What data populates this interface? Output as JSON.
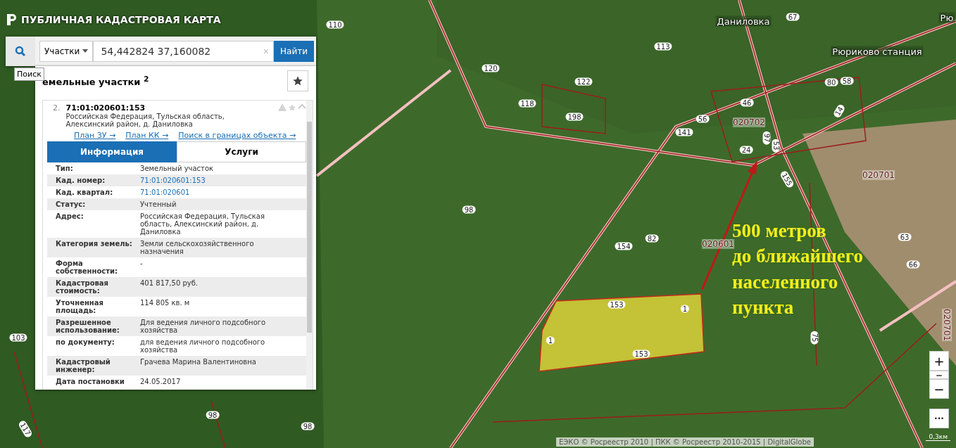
{
  "app": {
    "title": "ПУБЛИЧНАЯ КАДАСТРОВАЯ КАРТА"
  },
  "search": {
    "type_label": "Участки",
    "value": "54,442824 37,160082",
    "clear": "×",
    "submit": "Найти",
    "tooltip": "Поиск"
  },
  "results": {
    "title": "емельные участки $^{2}$",
    "item": {
      "number": "2.",
      "cad_number": "71:01:020601:153",
      "address": "Российская Федерация, Тульская область, Алексинский район, д. Даниловка",
      "expanded": true,
      "links": [
        "План ЗУ →",
        "План КК →",
        "Поиск в границах объекта →"
      ],
      "tabs": [
        {
          "label": "Информация",
          "selected": true
        },
        {
          "label": "Услуги",
          "selected": false
        }
      ],
      "rows": [
        {
          "label": "Тип:",
          "value": "Земельный участок",
          "kind": "text"
        },
        {
          "label": "Кад. номер:",
          "value": "71:01:020601:153",
          "kind": "link"
        },
        {
          "label": "Кад. квартал:",
          "value": "71:01:020601",
          "kind": "link"
        },
        {
          "label": "Статус:",
          "value": "Учтенный",
          "kind": "text"
        },
        {
          "label": "Адрес:",
          "value": "Российская Федерация, Тульская область, Алексинский район, д. Даниловка",
          "kind": "text"
        },
        {
          "label": "Категория земель:",
          "value": "Земли сельскохозяйственного назначения",
          "kind": "text"
        },
        {
          "label": "Форма собственности:",
          "value": "-",
          "kind": "text"
        },
        {
          "label": "Кадастровая стоимость:",
          "value": "401 817,50 руб.",
          "kind": "text"
        },
        {
          "label": "Уточненная площадь:",
          "value": "114 805 кв. м",
          "kind": "text"
        },
        {
          "label": "Разрешенное использование:",
          "value": "Для ведения личного подсобного хозяйства",
          "kind": "text"
        },
        {
          "label": "по документу:",
          "value": "для ведения личного подсобного хозяйства",
          "kind": "text"
        },
        {
          "label": "Кадастровый инженер:",
          "value": "Грачева Марина Валентиновна",
          "kind": "text"
        },
        {
          "label": "Дата постановки",
          "value": "24.05.2017",
          "kind": "text"
        }
      ]
    }
  },
  "map": {
    "labels": [
      {
        "text": "110",
        "kind": "parcel"
      },
      {
        "text": "120",
        "kind": "parcel"
      },
      {
        "text": "122",
        "kind": "parcel"
      },
      {
        "text": "118",
        "kind": "parcel"
      },
      {
        "text": "198",
        "kind": "parcel"
      },
      {
        "text": "113",
        "kind": "parcel"
      },
      {
        "text": "Даниловка",
        "kind": "place"
      },
      {
        "text": "67",
        "kind": "parcel"
      },
      {
        "text": "Рюриково станция",
        "kind": "place"
      },
      {
        "text": "Рю",
        "kind": "place"
      },
      {
        "text": "46",
        "kind": "parcel"
      },
      {
        "text": "56",
        "kind": "parcel"
      },
      {
        "text": "020702",
        "kind": "quarter"
      },
      {
        "text": "141",
        "kind": "parcel"
      },
      {
        "text": "24",
        "kind": "parcel"
      },
      {
        "text": "97",
        "kind": "parcel"
      },
      {
        "text": "53",
        "kind": "parcel"
      },
      {
        "text": "80",
        "kind": "parcel"
      },
      {
        "text": "58",
        "kind": "parcel"
      },
      {
        "text": "14",
        "kind": "parcel"
      },
      {
        "text": "020701",
        "kind": "quarter"
      },
      {
        "text": "155",
        "kind": "parcel"
      },
      {
        "text": "98",
        "kind": "parcel"
      },
      {
        "text": "154",
        "kind": "parcel"
      },
      {
        "text": "82",
        "kind": "parcel"
      },
      {
        "text": "020601",
        "kind": "quarter"
      },
      {
        "text": "63",
        "kind": "parcel"
      },
      {
        "text": "66",
        "kind": "parcel"
      },
      {
        "text": "75",
        "kind": "parcel"
      },
      {
        "text": "153",
        "kind": "parcel"
      },
      {
        "text": "153",
        "kind": "parcel"
      },
      {
        "text": "1",
        "kind": "parcel"
      },
      {
        "text": "1",
        "kind": "parcel"
      },
      {
        "text": "020701",
        "kind": "quarter"
      },
      {
        "text": "103",
        "kind": "parcel"
      },
      {
        "text": "117",
        "kind": "parcel"
      },
      {
        "text": "98",
        "kind": "parcel"
      },
      {
        "text": "98",
        "kind": "parcel"
      }
    ],
    "annotation": [
      "500 метров",
      "до ближайшего",
      "населенного",
      "пункта"
    ],
    "zoom": {
      "plus": "+",
      "more": "•••",
      "minus": "−",
      "extra": "•••"
    },
    "attribution": "ЕЭКО © Росреестр 2010 | ПКК © Росреестр 2010-2015 | DigitalGlobe",
    "scale": "0,3км"
  }
}
